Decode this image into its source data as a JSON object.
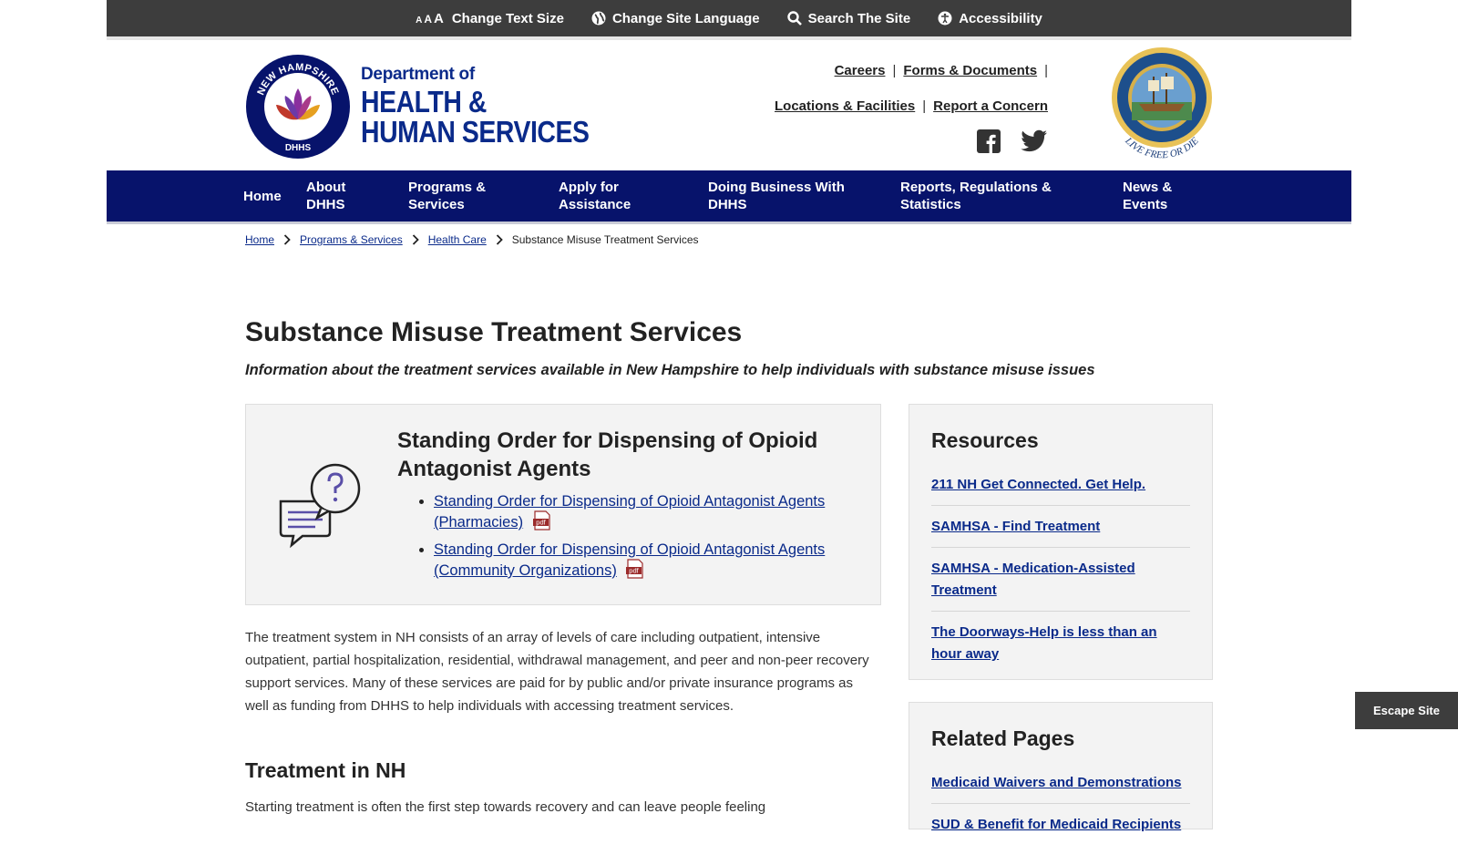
{
  "utility": {
    "text_size": "Change Text Size",
    "language": "Change Site Language",
    "search": "Search The Site",
    "accessibility": "Accessibility",
    "aaa": [
      "A",
      "A",
      "A"
    ]
  },
  "header": {
    "dept_line1": "Department of",
    "dept_line2": "HEALTH &",
    "dept_line3": "HUMAN SERVICES",
    "logo_top": "NEW HAMPSHIRE",
    "logo_bottom": "DHHS",
    "seal_motto": "LIVE FREE OR DIE",
    "links_row1": [
      "Careers",
      "Forms & Documents"
    ],
    "links_row2": [
      "Locations & Facilities",
      "Report a Concern"
    ]
  },
  "nav": [
    {
      "l1": "Home",
      "l2": ""
    },
    {
      "l1": "About",
      "l2": "DHHS"
    },
    {
      "l1": "Programs &",
      "l2": "Services"
    },
    {
      "l1": "Apply for",
      "l2": "Assistance"
    },
    {
      "l1": "Doing Business With",
      "l2": "DHHS"
    },
    {
      "l1": "Reports, Regulations &",
      "l2": "Statistics"
    },
    {
      "l1": "News &",
      "l2": "Events"
    }
  ],
  "breadcrumb": [
    "Home",
    "Programs & Services",
    "Health Care",
    "Substance Misuse Treatment Services"
  ],
  "page": {
    "title": "Substance Misuse Treatment Services",
    "subtitle": "Information about the treatment services available in New Hampshire to help individuals with substance misuse issues"
  },
  "feature": {
    "title": "Standing Order for Dispensing of Opioid Antagonist Agents",
    "links": [
      "Standing Order for Dispensing of Opioid Antagonist Agents (Pharmacies)",
      "Standing Order for Dispensing of Opioid Antagonist Agents (Community Organizations)"
    ],
    "pdf_label": "pdf"
  },
  "body": {
    "paragraph1": "The treatment system in NH consists of an array of levels of care including outpatient, intensive outpatient, partial hospitalization, residential, withdrawal management, and peer and non-peer recovery support services.  Many of these services are paid for by public and/or private insurance programs as well as funding from DHHS to help individuals with accessing treatment services.",
    "heading2": "Treatment in NH",
    "paragraph2": "Starting treatment is often the first step towards recovery and can leave people feeling"
  },
  "resources": {
    "title": "Resources",
    "links": [
      "211 NH Get Connected. Get Help.",
      "SAMHSA - Find Treatment",
      "SAMHSA - Medication-Assisted Treatment",
      "The Doorways-Help is less than an hour away"
    ]
  },
  "related": {
    "title": "Related Pages",
    "links": [
      "Medicaid Waivers and Demonstrations",
      "SUD & Benefit for Medicaid Recipients"
    ]
  },
  "escape": "Escape Site",
  "colors": {
    "nav": "#07136b",
    "link": "#0a2a8a",
    "utility": "#3d3d3d"
  }
}
